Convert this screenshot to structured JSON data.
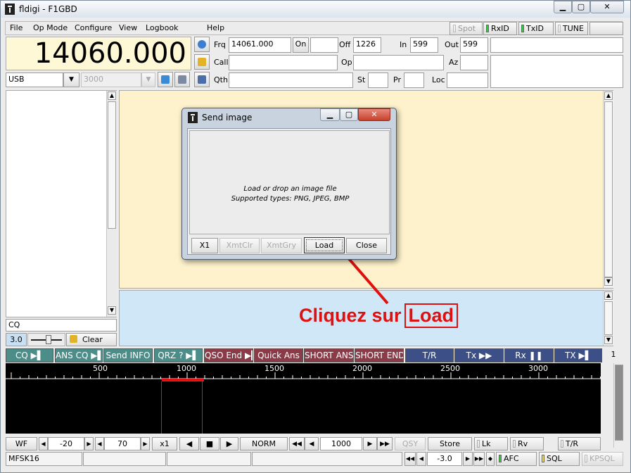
{
  "window": {
    "title": "fldigi - F1GBD",
    "min": "▁",
    "max": "▢",
    "close": "✕"
  },
  "menu": {
    "items": [
      "File",
      "Op Mode",
      "Configure",
      "View",
      "Logbook",
      "Help"
    ]
  },
  "top_toggles": {
    "spot": "Spot",
    "rxid": "RxID",
    "txid": "TxID",
    "tune": "TUNE"
  },
  "frequency": {
    "display": "14060.000"
  },
  "mode": {
    "value": "USB",
    "bandwidth": "3000"
  },
  "log": {
    "frq_label": "Frq",
    "frq_value": "14061.000",
    "on_label": "On",
    "on_value": "",
    "off_label": "Off",
    "off_value": "1226",
    "in_label": "In",
    "in_value": "599",
    "out_label": "Out",
    "out_value": "599",
    "call_label": "Call",
    "call_value": "",
    "op_label": "Op",
    "op_value": "",
    "az_label": "Az",
    "az_value": "",
    "qth_label": "Qth",
    "qth_value": "",
    "st_label": "St",
    "st_value": "",
    "pr_label": "Pr",
    "pr_value": "",
    "loc_label": "Loc",
    "loc_value": ""
  },
  "left_controls": {
    "cq_text": "CQ",
    "squelch_value": "3.0",
    "clear_label": "Clear"
  },
  "macros": [
    {
      "label": "CQ",
      "group": "m1"
    },
    {
      "label": "ANS CQ",
      "group": "m1"
    },
    {
      "label": "Send INFO",
      "group": "m1"
    },
    {
      "label": "QRZ ?",
      "group": "m1"
    },
    {
      "label": "QSO End",
      "group": "m2"
    },
    {
      "label": "Quick Ans",
      "group": "m2"
    },
    {
      "label": "SHORT ANS",
      "group": "m2"
    },
    {
      "label": "SHORT END",
      "group": "m2"
    },
    {
      "label": "T/R",
      "group": "m3"
    },
    {
      "label": "Tx",
      "group": "m3"
    },
    {
      "label": "Rx",
      "group": "m3"
    },
    {
      "label": "TX",
      "group": "m3"
    }
  ],
  "macro_page": "1",
  "waterfall": {
    "scale_labels": [
      "500",
      "1000",
      "1500",
      "2000",
      "2500",
      "3000"
    ],
    "wf_mode": "WF",
    "level_1": "-20",
    "level_2": "70",
    "zoom": "x1",
    "speed": "NORM",
    "carrier": "1000",
    "qsy": "QSY",
    "store": "Store",
    "lk": "Lk",
    "rv": "Rv",
    "tr": "T/R"
  },
  "status_bar": {
    "mode": "MFSK16",
    "offset": "-3.0",
    "afc": "AFC",
    "sql": "SQL",
    "kpsql": "KPSQL"
  },
  "dialog": {
    "title": "Send image",
    "message_line1": "Load or drop an image file",
    "message_line2": "Supported types: PNG, JPEG, BMP",
    "buttons": {
      "x1": "X1",
      "xmtclr": "XmtClr",
      "xmtgry": "XmtGry",
      "load": "Load",
      "close": "Close"
    }
  },
  "annotation": {
    "text": "Cliquez sur",
    "highlight": "Load",
    "color": "#e01010"
  },
  "colors": {
    "freq_bg": "#fff8d6",
    "rx_bg": "#fdf2cc",
    "tx_bg": "#cfe7f6",
    "macro_green": "#4d8d89",
    "macro_red": "#8b3a48",
    "macro_blue": "#3c4f86",
    "cursor": "#e81010"
  }
}
